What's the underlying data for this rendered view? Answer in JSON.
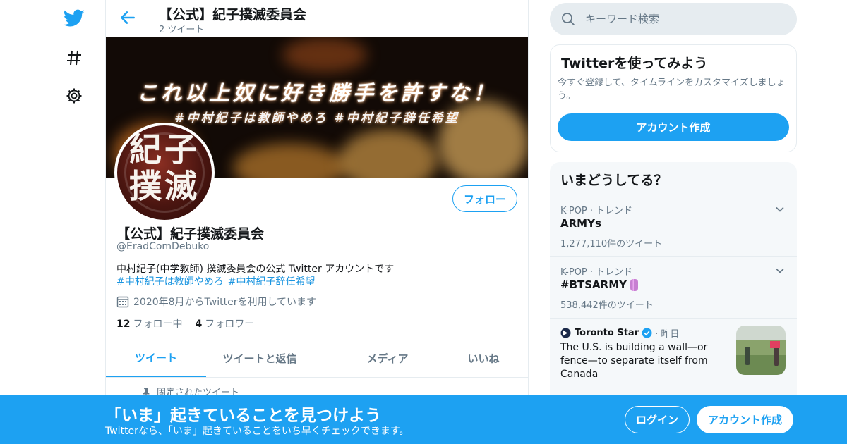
{
  "colors": {
    "accent": "#1da1f2",
    "text_primary": "#14171a",
    "text_secondary": "#657786",
    "link": "#1b95e0"
  },
  "nav": {
    "icons": [
      "twitter-logo-icon",
      "hashtag-icon",
      "gear-icon"
    ]
  },
  "header": {
    "name": "【公式】紀子撲滅委員会",
    "tweet_count": "2 ツイート"
  },
  "banner": {
    "line1": "これ以上奴に好き勝手を許すな！",
    "line2": "#中村紀子は教師やめろ #中村紀子辞任希望"
  },
  "avatar": {
    "text": "紀子\n撲滅"
  },
  "profile": {
    "follow_label": "フォロー",
    "name": "【公式】紀子撲滅委員会",
    "handle": "@EradComDebuko",
    "bio": "中村紀子(中学教師) 撲滅委員会の公式 Twitter アカウントです",
    "hashtags": [
      "#中村紀子は教師やめろ",
      "#中村紀子辞任希望"
    ],
    "joined": "2020年8月からTwitterを利用しています",
    "following_count": "12",
    "following_label": "フォロー中",
    "followers_count": "4",
    "followers_label": "フォロワー"
  },
  "tabs": [
    {
      "label": "ツイート",
      "active": true
    },
    {
      "label": "ツイートと返信",
      "active": false
    },
    {
      "label": "メディア",
      "active": false
    },
    {
      "label": "いいね",
      "active": false
    }
  ],
  "pinned_label": "固定されたツイート",
  "search": {
    "placeholder": "キーワード検索"
  },
  "signup_card": {
    "title": "Twitterを使ってみよう",
    "description": "今すぐ登録して、タイムラインをカスタマイズしましょう。",
    "button": "アカウント作成"
  },
  "trends": {
    "title": "いまどうしてる？",
    "items": [
      {
        "meta": "K-POP · トレンド",
        "name": "ARMYs",
        "count": "1,277,110件のツイート"
      },
      {
        "meta": "K-POP · トレンド",
        "name": "#BTSARMY",
        "count": "538,442件のツイート"
      }
    ],
    "news": {
      "source": "Toronto Star",
      "time": "· 昨日",
      "headline": "The U.S. is building a wall—or fence—to separate itself from Canada"
    }
  },
  "bottom_bar": {
    "title": "「いま」起きていることを見つけよう",
    "subtitle": "Twitterなら、「いま」起きていることをいち早くチェックできます。",
    "login": "ログイン",
    "signup": "アカウント作成"
  }
}
